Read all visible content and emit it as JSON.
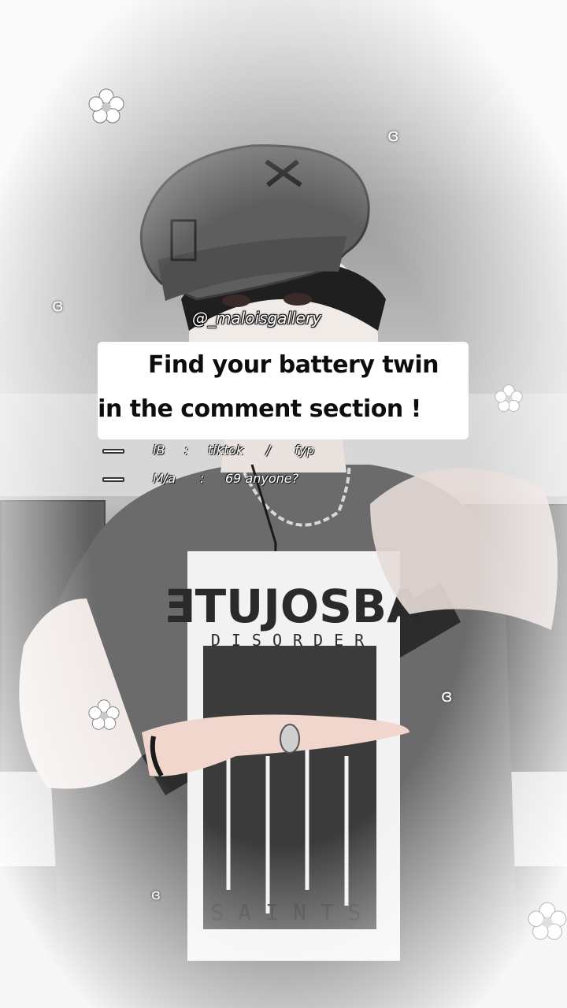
{
  "overlay": {
    "handle": "@_maloisgallery",
    "title_line1": "Find your battery twin",
    "title_line2": "in the comment section !",
    "info_rows": [
      {
        "key": "iB",
        "colon": ":",
        "value1": "tiktok",
        "sep": "/",
        "value2": "fyp"
      },
      {
        "key": "M/a",
        "colon": ":",
        "value1": "69 anyone?",
        "sep": "",
        "value2": ""
      }
    ]
  },
  "photo": {
    "shirt_text_top": "ƎTUJOSBA",
    "shirt_text_sub": "DISORDER",
    "shirt_text_bottom": "SAINTS"
  },
  "decor": {
    "bow_glyph": "ɞ"
  }
}
